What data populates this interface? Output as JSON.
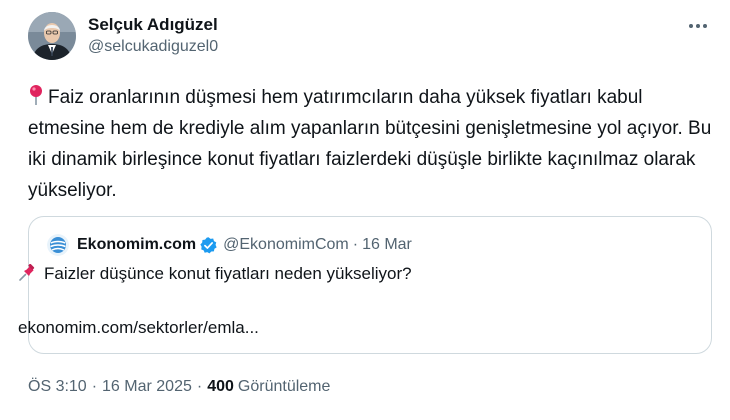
{
  "author": {
    "name": "Selçuk Adıgüzel",
    "handle": "@selcukadiguzel0"
  },
  "tweet": {
    "emoji_icon": "round-pushpin-icon",
    "text": "Faiz oranlarının düşmesi hem yatırımcıların daha yüksek fiyatları kabul etmesine hem de krediyle alım yapanların bütçesini genişletmesine yol açıyor. Bu iki dinamik birleşince konut fiyatları faizlerdeki düşüşle birlikte kaçınılmaz olarak yükseliyor."
  },
  "quote": {
    "name": "Ekonomim.com",
    "verified_icon": "verified-badge-icon",
    "handle": "@EkonomimCom",
    "separator": "·",
    "date": "16 Mar",
    "emoji_icon": "pushpin-icon",
    "text": "Faizler düşünce konut fiyatları neden yükseliyor?",
    "link": "ekonomim.com/sektorler/emla..."
  },
  "meta": {
    "time": "ÖS 3:10",
    "separator": "·",
    "date": "16 Mar 2025",
    "separator2": "·",
    "views": "400",
    "views_label": "Görüntüleme"
  },
  "colors": {
    "text": "#0f1419",
    "secondary": "#536471",
    "border": "#cfd9de",
    "verified": "#1d9bf0",
    "pin": "#e0245e"
  }
}
